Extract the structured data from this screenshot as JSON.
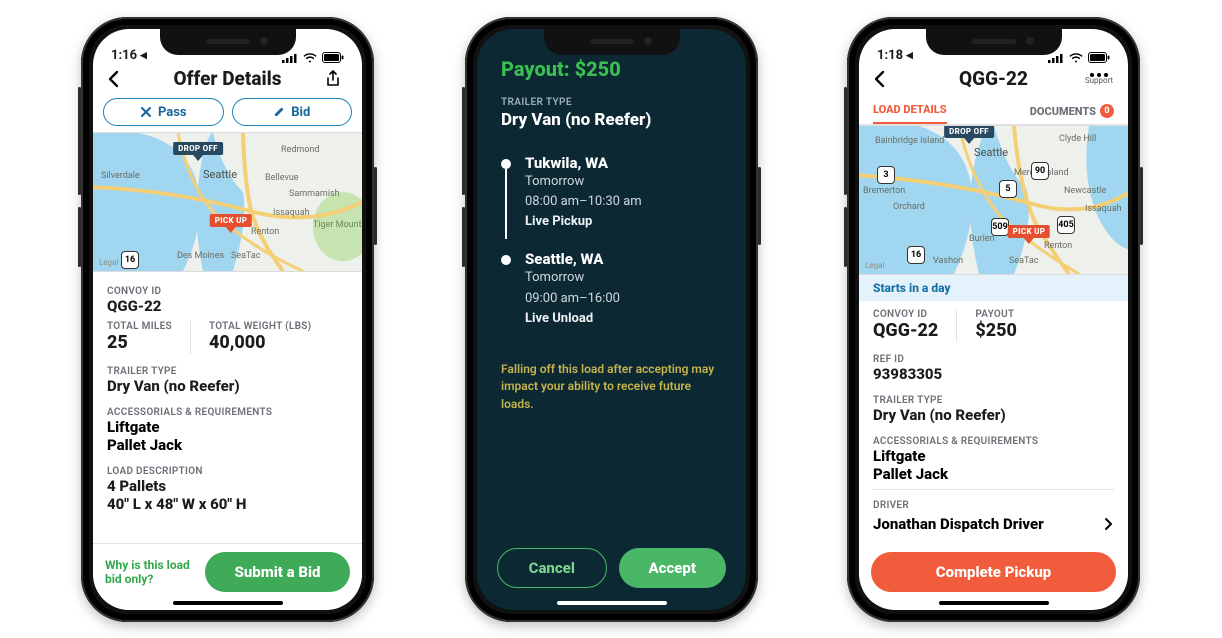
{
  "phone1": {
    "status_time": "1:16 ◂",
    "nav_title": "Offer Details",
    "pass_label": "Pass",
    "bid_label": "Bid",
    "map": {
      "pickup_label": "PICK UP",
      "dropoff_label": "DROP OFF",
      "legal": "Legal",
      "cities": [
        "Silverdale",
        "Seattle",
        "Redmond",
        "Bellevue",
        "Sammamish",
        "Issaquah",
        "Renton",
        "Des Moines",
        "SeaTac",
        "Tiger Mountain State Forest"
      ],
      "route_shield": "16"
    },
    "labels": {
      "convoy_id": "CONVOY ID",
      "total_miles": "TOTAL MILES",
      "total_weight": "TOTAL WEIGHT (LBS)",
      "trailer_type": "TRAILER TYPE",
      "accessorials": "ACCESSORIALS & REQUIREMENTS",
      "load_desc": "LOAD DESCRIPTION"
    },
    "values": {
      "convoy_id": "QGG-22",
      "total_miles": "25",
      "total_weight": "40,000",
      "trailer_type": "Dry Van (no Reefer)",
      "accessorials": [
        "Liftgate",
        "Pallet Jack"
      ],
      "load_desc_line1": "4 Pallets",
      "load_desc_line2": "40\" L x 48\" W x 60\" H"
    },
    "footer_link": "Why is this load bid only?",
    "submit_label": "Submit a Bid"
  },
  "phone2": {
    "payout_label": "Payout:",
    "payout_value": "$250",
    "trailer_label": "TRAILER TYPE",
    "trailer_value": "Dry Van (no Reefer)",
    "stops": [
      {
        "city": "Tukwila, WA",
        "day": "Tomorrow",
        "window": "08:00 am–10:30 am",
        "type": "Live Pickup"
      },
      {
        "city": "Seattle, WA",
        "day": "Tomorrow",
        "window": "09:00 am–16:00",
        "type": "Live Unload"
      }
    ],
    "warning": "Falling off this load after accepting may impact your ability to receive future loads.",
    "cancel_label": "Cancel",
    "accept_label": "Accept"
  },
  "phone3": {
    "status_time": "1:18 ◂",
    "nav_title": "QGG-22",
    "support_caption": "Support",
    "tabs": {
      "load_details": "LOAD DETAILS",
      "documents": "DOCUMENTS",
      "documents_count": "0"
    },
    "map": {
      "pickup_label": "PICK UP",
      "dropoff_label": "DROP OFF",
      "legal": "Legal",
      "cities": [
        "Bainbridge Island",
        "Seattle",
        "Clyde Hill",
        "Mercer Island",
        "Newcastle",
        "Issaquah",
        "Bremerton",
        "Orchard",
        "Burien",
        "Vashon",
        "SeaTac",
        "Renton"
      ],
      "route_shields": [
        "3",
        "90",
        "5",
        "405",
        "16",
        "509"
      ]
    },
    "banner": "Starts in a day",
    "labels": {
      "convoy_id": "CONVOY ID",
      "payout": "PAYOUT",
      "ref_id": "REF ID",
      "trailer_type": "TRAILER TYPE",
      "accessorials": "ACCESSORIALS & REQUIREMENTS",
      "driver": "DRIVER"
    },
    "values": {
      "convoy_id": "QGG-22",
      "payout": "$250",
      "ref_id": "93983305",
      "trailer_type": "Dry Van (no Reefer)",
      "accessorials": [
        "Liftgate",
        "Pallet Jack"
      ],
      "driver": "Jonathan Dispatch Driver"
    },
    "cta": "Complete Pickup"
  }
}
